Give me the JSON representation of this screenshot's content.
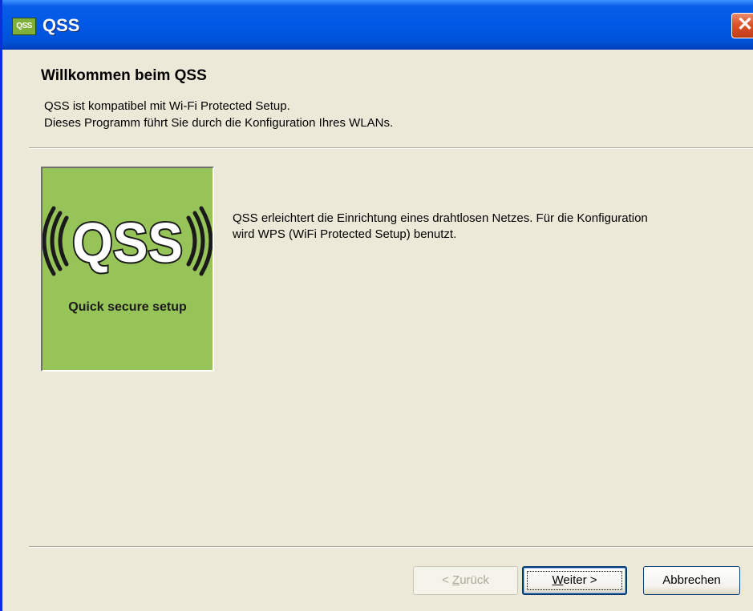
{
  "window": {
    "title": "QSS",
    "icon_label": "QSS",
    "close_icon": "close-icon",
    "close_glyph": "✕"
  },
  "header": {
    "title": "Willkommen beim QSS",
    "line1": "QSS ist kompatibel mit Wi-Fi Protected Setup.",
    "line2": "Dieses Programm führt Sie durch die Konfiguration Ihres WLANs."
  },
  "logo": {
    "text": "QSS",
    "caption": "Quick secure setup",
    "background": "#97c459"
  },
  "body": {
    "description": "QSS erleichtert die Einrichtung eines drahtlosen Netzes. Für die Konfiguration wird WPS (WiFi Protected Setup) benutzt."
  },
  "buttons": {
    "back_prefix": "< ",
    "back_key": "Z",
    "back_rest": "urück",
    "next_key": "W",
    "next_rest": "eiter >",
    "cancel": "Abbrechen"
  }
}
